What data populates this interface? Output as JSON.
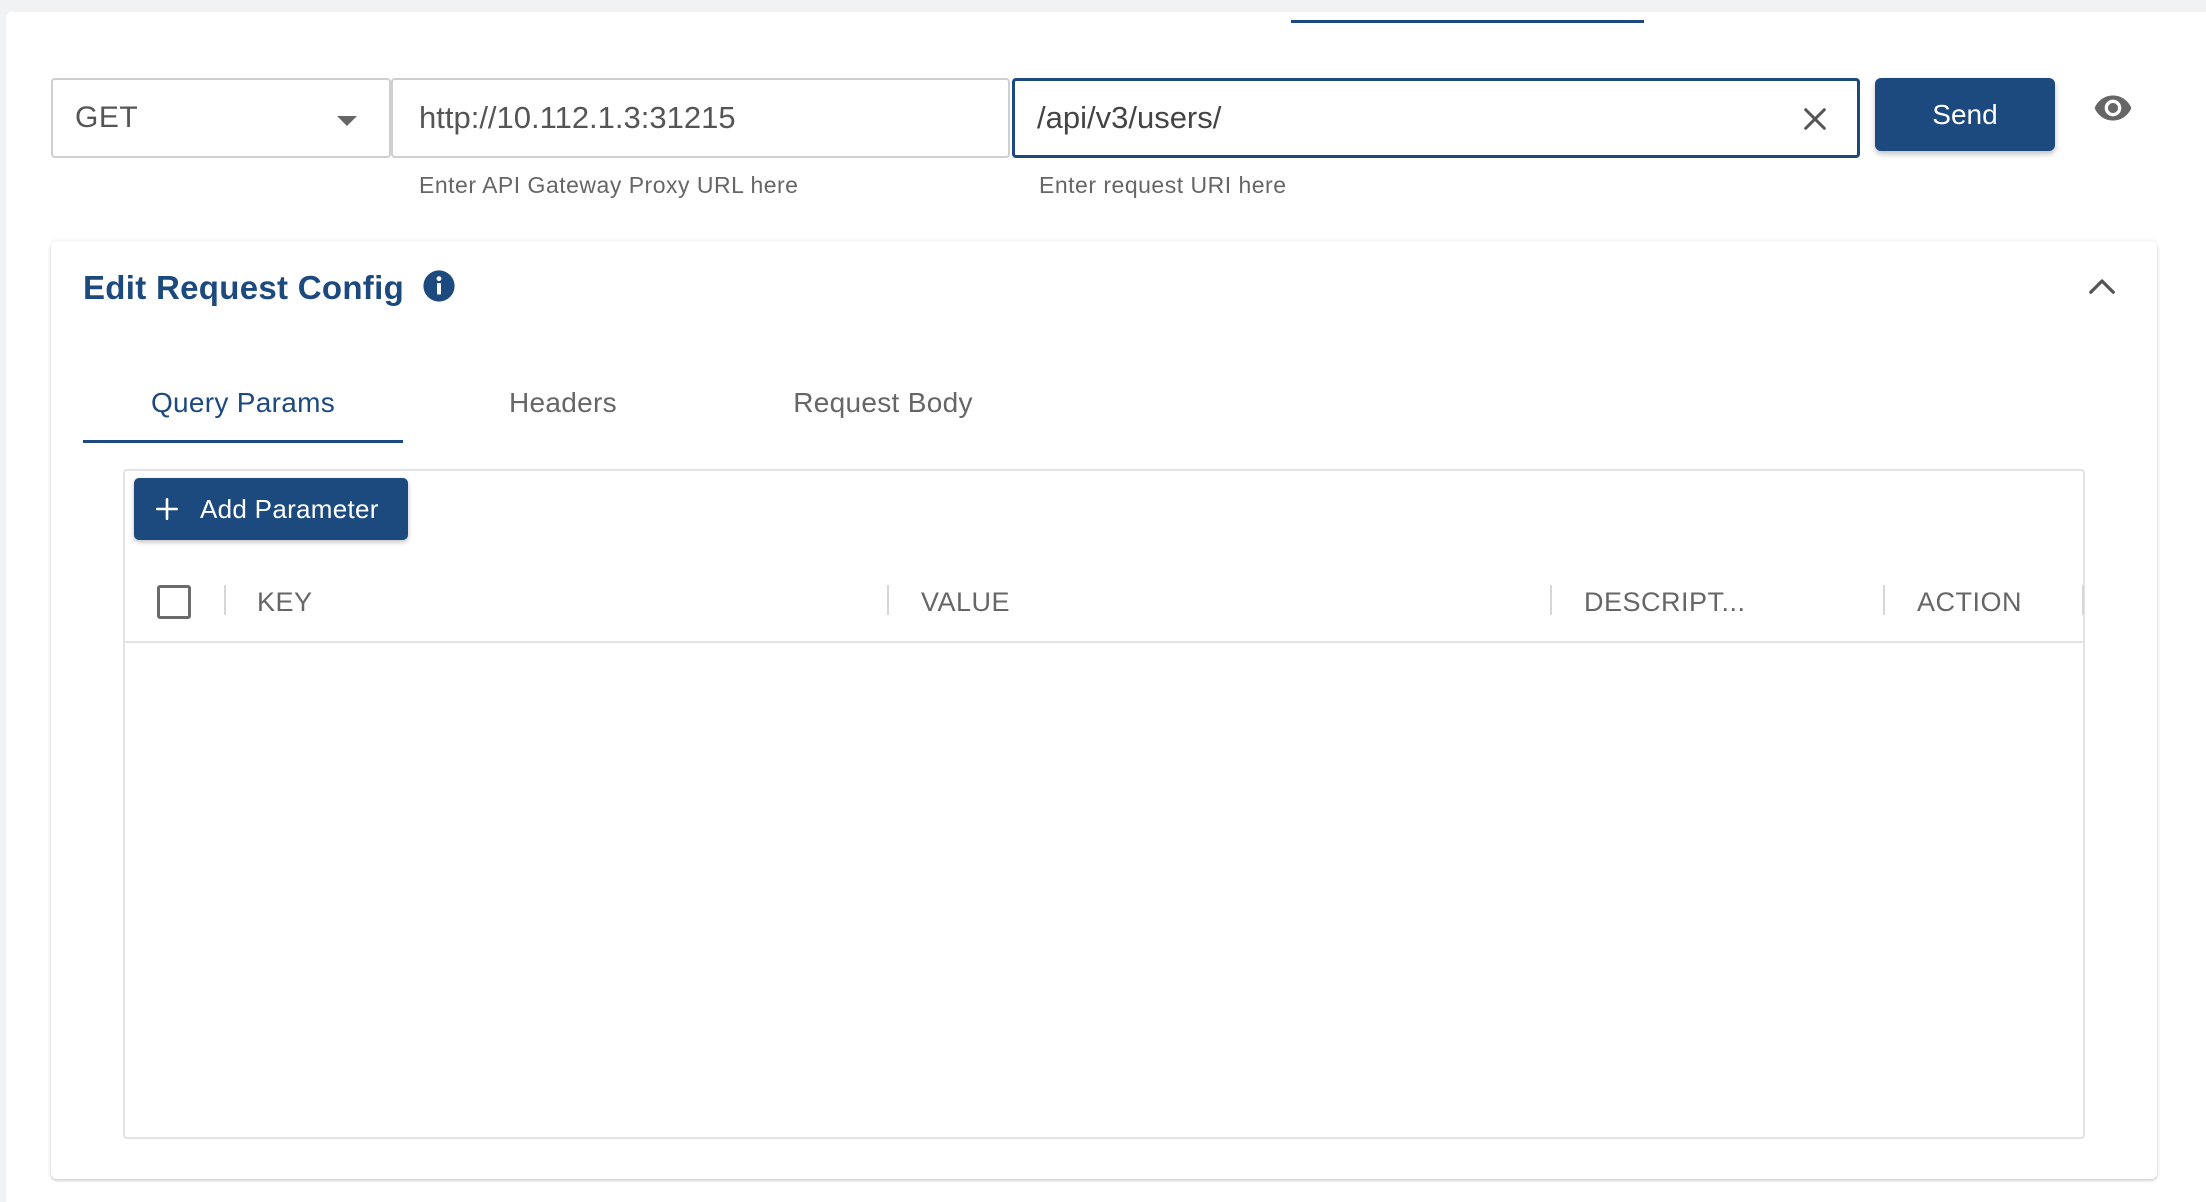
{
  "request": {
    "method": "GET",
    "proxy_url": "http://10.112.1.3:31215",
    "proxy_helper": "Enter API Gateway Proxy URL here",
    "uri": "/api/v3/users/",
    "uri_helper": "Enter request URI here",
    "send_label": "Send"
  },
  "config": {
    "title": "Edit Request Config",
    "tabs": [
      {
        "label": "Query Params",
        "active": true
      },
      {
        "label": "Headers",
        "active": false
      },
      {
        "label": "Request Body",
        "active": false
      }
    ],
    "add_button_label": "Add Parameter",
    "columns": [
      "KEY",
      "VALUE",
      "DESCRIPT...",
      "ACTION"
    ]
  },
  "colors": {
    "primary": "#1d4a7e",
    "border": "#cfcfcf",
    "muted_text": "#666666"
  },
  "icons": {
    "clear": "close-icon",
    "view": "eye-icon",
    "info": "info-icon",
    "collapse": "chevron-up-icon",
    "add": "plus-icon"
  }
}
